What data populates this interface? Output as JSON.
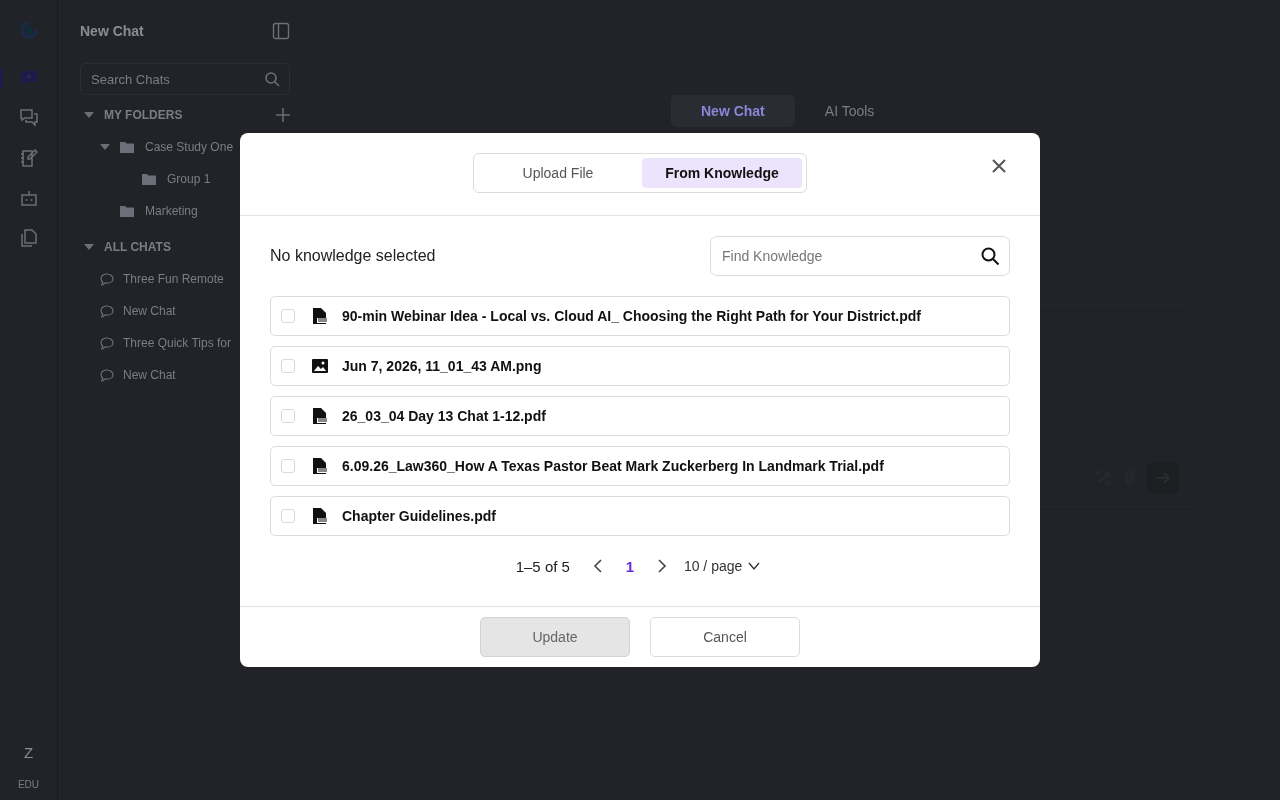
{
  "rail": {
    "items": [
      {
        "kind": "new-chat",
        "selected": true
      },
      {
        "kind": "chats",
        "selected": false
      },
      {
        "kind": "notes",
        "selected": false
      },
      {
        "kind": "bot",
        "selected": false
      },
      {
        "kind": "documents",
        "selected": false
      }
    ],
    "avatar": "Z",
    "org": "EDU"
  },
  "sidebar": {
    "title": "New Chat",
    "search": {
      "placeholder": "Search Chats"
    },
    "folders": {
      "title": "MY FOLDERS",
      "expanded": true,
      "items": [
        {
          "label": "Case Study One",
          "expanded": true,
          "children": [
            {
              "label": "Group 1"
            }
          ]
        },
        {
          "label": "Marketing"
        }
      ]
    },
    "chats": {
      "title": "ALL CHATS",
      "expanded": true,
      "items": [
        {
          "label": "Three Fun Remote"
        },
        {
          "label": "New Chat"
        },
        {
          "label": "Three Quick Tips for"
        },
        {
          "label": "New Chat"
        }
      ]
    }
  },
  "main": {
    "tabs": [
      {
        "label": "New Chat",
        "selected": true
      },
      {
        "label": "AI Tools",
        "selected": false
      }
    ]
  },
  "modal": {
    "tabs": [
      {
        "label": "Upload File",
        "selected": false
      },
      {
        "label": "From Knowledge",
        "selected": true
      }
    ],
    "status": "No knowledge selected",
    "search": {
      "placeholder": "Find Knowledge"
    },
    "files": [
      {
        "name": "90-min Webinar Idea - Local vs. Cloud AI_ Choosing the Right Path for Your District.pdf",
        "kind": "pdf",
        "checked": false
      },
      {
        "name": "Jun 7, 2026, 11_01_43 AM.png",
        "kind": "image",
        "checked": false
      },
      {
        "name": "26_03_04 Day 13 Chat 1-12.pdf",
        "kind": "pdf",
        "checked": false
      },
      {
        "name": "6.09.26_Law360_How A Texas Pastor Beat Mark Zuckerberg In Landmark Trial.pdf",
        "kind": "pdf",
        "checked": false
      },
      {
        "name": "Chapter Guidelines.pdf",
        "kind": "pdf",
        "checked": false
      }
    ],
    "pagination": {
      "range": "1–5 of 5",
      "pages": [
        {
          "label": "1",
          "selected": true
        }
      ],
      "page_size": "10 / page"
    },
    "buttons": [
      {
        "label": "Update",
        "disabled": true
      },
      {
        "label": "Cancel",
        "disabled": false
      }
    ]
  }
}
